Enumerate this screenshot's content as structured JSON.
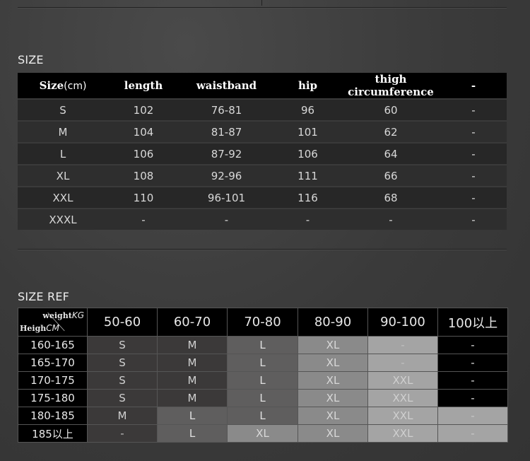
{
  "size_section": {
    "heading": "SIZE",
    "header": {
      "size": "Size",
      "unit": "(cm)",
      "columns": [
        "length",
        "waistband",
        "hip",
        "thigh circumference",
        "-"
      ]
    },
    "rows": [
      [
        "S",
        "102",
        "76-81",
        "96",
        "60",
        "-"
      ],
      [
        "M",
        "104",
        "81-87",
        "101",
        "62",
        "-"
      ],
      [
        "L",
        "106",
        "87-92",
        "106",
        "64",
        "-"
      ],
      [
        "XL",
        "108",
        "92-96",
        "111",
        "66",
        "-"
      ],
      [
        "XXL",
        "110",
        "96-101",
        "116",
        "68",
        "-"
      ],
      [
        "XXXL",
        "-",
        "-",
        "-",
        "-",
        "-"
      ]
    ]
  },
  "size_ref_section": {
    "heading": "SIZE REF",
    "corner": {
      "weight": "weight",
      "weight_unit": "KG",
      "height": "Heigh",
      "height_unit": "CM"
    },
    "weight_columns": [
      "50-60",
      "60-70",
      "70-80",
      "80-90",
      "90-100",
      "100以上"
    ],
    "rows": [
      {
        "height": "160-165",
        "cells": [
          "S",
          "M",
          "L",
          "XL",
          "-",
          "-"
        ]
      },
      {
        "height": "165-170",
        "cells": [
          "S",
          "M",
          "L",
          "XL",
          "-",
          "-"
        ]
      },
      {
        "height": "170-175",
        "cells": [
          "S",
          "M",
          "L",
          "XL",
          "XXL",
          "-"
        ]
      },
      {
        "height": "175-180",
        "cells": [
          "S",
          "M",
          "L",
          "XL",
          "XXL",
          "-"
        ]
      },
      {
        "height": "180-185",
        "cells": [
          "M",
          "L",
          "L",
          "XL",
          "XXL",
          "-"
        ]
      },
      {
        "height": "185以上",
        "cells": [
          "-",
          "L",
          "XL",
          "XL",
          "XXL",
          "-"
        ]
      }
    ],
    "size_colors": {
      "S": "#3b3939",
      "M": "#3b3939",
      "L": "#5f5e5e",
      "XL": "#8a8a8a",
      "XXL": "#a4a4a4",
      "-": "#a4a4a4"
    },
    "size_text_colors": {
      "S": "#d0d0d0",
      "M": "#d0d0d0",
      "L": "#e0e0e0",
      "XL": "#d8d8d8",
      "XXL": "#cfcfcf",
      "-": "#c8c8c8"
    }
  }
}
